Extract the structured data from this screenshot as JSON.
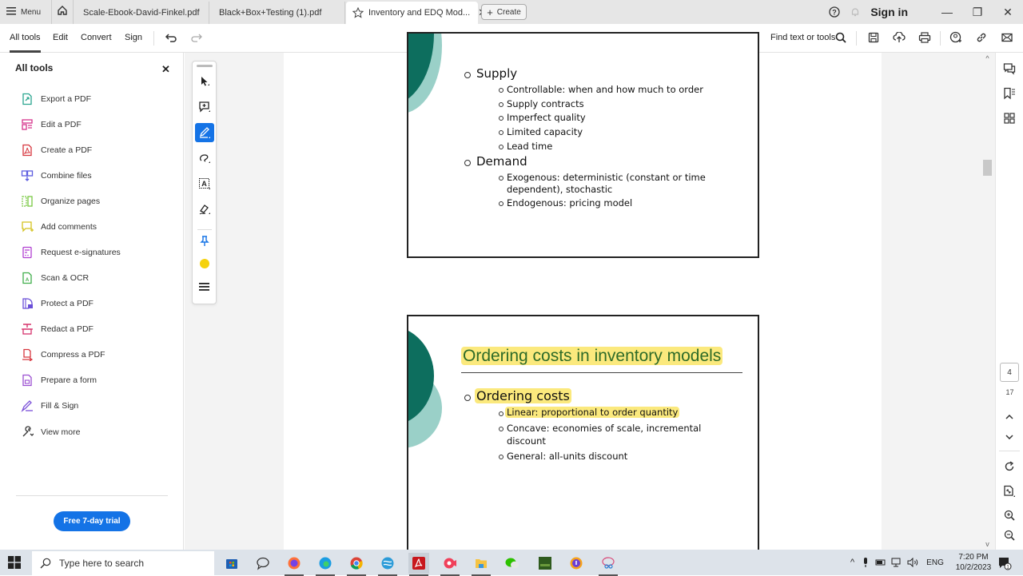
{
  "tabbar": {
    "menu_label": "Menu",
    "tabs": [
      {
        "label": "Scale-Ebook-David-Finkel.pdf"
      },
      {
        "label": "Black+Box+Testing (1).pdf"
      },
      {
        "label": "Inventory and EDQ Mod...",
        "active": true
      }
    ],
    "create_label": "Create",
    "sign_in_label": "Sign in"
  },
  "toolbar": {
    "items": [
      "All tools",
      "Edit",
      "Convert",
      "Sign"
    ],
    "find_label": "Find text or tools"
  },
  "left_panel": {
    "title": "All tools",
    "items": [
      {
        "label": "Export a PDF",
        "icon": "export-pdf-icon",
        "color": "#2aa58f"
      },
      {
        "label": "Edit a PDF",
        "icon": "edit-pdf-icon",
        "color": "#d6338c"
      },
      {
        "label": "Create a PDF",
        "icon": "create-pdf-icon",
        "color": "#d7373f"
      },
      {
        "label": "Combine files",
        "icon": "combine-files-icon",
        "color": "#5c5ce0"
      },
      {
        "label": "Organize pages",
        "icon": "organize-pages-icon",
        "color": "#7ac943"
      },
      {
        "label": "Add comments",
        "icon": "add-comments-icon",
        "color": "#d4c21e"
      },
      {
        "label": "Request e-signatures",
        "icon": "request-esign-icon",
        "color": "#b03fd1"
      },
      {
        "label": "Scan & OCR",
        "icon": "scan-ocr-icon",
        "color": "#3fae4a"
      },
      {
        "label": "Protect a PDF",
        "icon": "protect-pdf-icon",
        "color": "#6a4fd8"
      },
      {
        "label": "Redact a PDF",
        "icon": "redact-pdf-icon",
        "color": "#d6336c"
      },
      {
        "label": "Compress a PDF",
        "icon": "compress-pdf-icon",
        "color": "#d7373f"
      },
      {
        "label": "Prepare a form",
        "icon": "prepare-form-icon",
        "color": "#9b4fd1"
      },
      {
        "label": "Fill & Sign",
        "icon": "fill-sign-icon",
        "color": "#7a4fd8"
      },
      {
        "label": "View more",
        "icon": "view-more-icon",
        "color": "#333333"
      }
    ],
    "trial_label": "Free 7-day trial"
  },
  "document": {
    "slide1": {
      "sections": [
        {
          "heading": "Supply",
          "items": [
            "Controllable: when and how much to order",
            "Supply contracts",
            "Imperfect quality",
            "Limited capacity",
            "Lead time"
          ]
        },
        {
          "heading": "Demand",
          "items": [
            "Exogenous: deterministic (constant or time",
            "dependent), stochastic",
            "Endogenous: pricing model"
          ]
        }
      ]
    },
    "slide2": {
      "title": "Ordering costs in inventory models",
      "heading": "Ordering costs",
      "items": [
        "Linear: proportional to order quantity",
        "Concave: economies of scale, incremental",
        "discount",
        "General: all-units discount"
      ]
    },
    "highlight_color": "#fbe97d",
    "accent_dark": "#0d6e5e",
    "accent_light": "#9ad0c8"
  },
  "page_nav": {
    "current_page": "4",
    "total_pages": "17"
  },
  "taskbar": {
    "search_placeholder": "Type here to search",
    "language": "ENG",
    "time": "7:20 PM",
    "date": "10/2/2023",
    "notification_count": "1"
  }
}
